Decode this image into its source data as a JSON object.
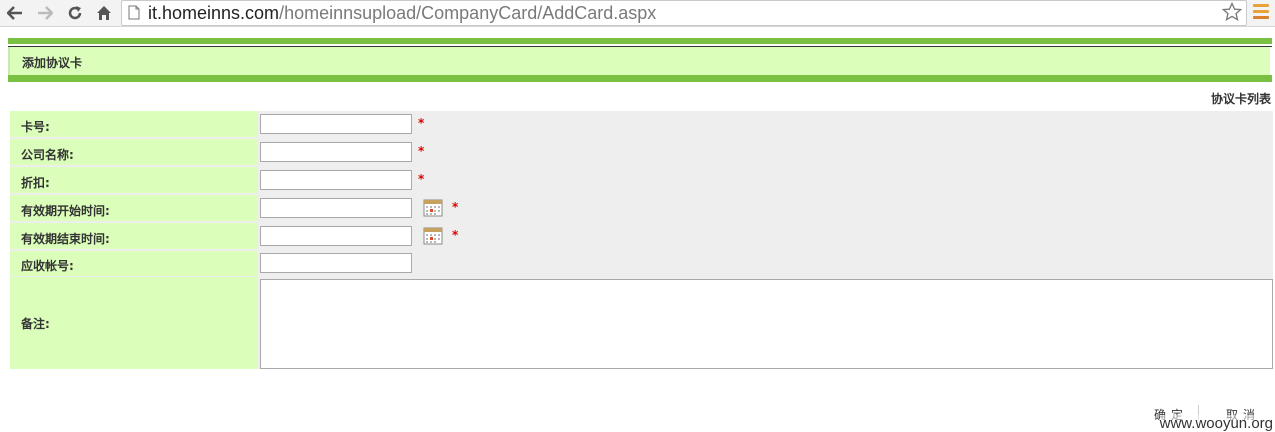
{
  "browser": {
    "url_host": "it.homeinns.com",
    "url_path": "/homeinnsupload/CompanyCard/AddCard.aspx",
    "icons": [
      "back-icon",
      "forward-icon",
      "reload-icon",
      "home-icon",
      "page-icon",
      "star-icon",
      "menu-icon"
    ]
  },
  "page": {
    "section_title": "添加协议卡",
    "list_link": "协议卡列表",
    "required_mark": "*",
    "form": {
      "card_no_label": "卡号:",
      "company_label": "公司名称:",
      "discount_label": "折扣:",
      "start_label": "有效期开始时间:",
      "end_label": "有效期结束时间:",
      "account_label": "应收帐号:",
      "remark_label": "备注:"
    },
    "buttons": {
      "confirm": "确定",
      "cancel": "取消"
    },
    "watermark": "www.wooyun.org"
  },
  "colors": {
    "green_band": "#7ac143",
    "header_bg": "#dbffbb",
    "required": "#e00000"
  }
}
